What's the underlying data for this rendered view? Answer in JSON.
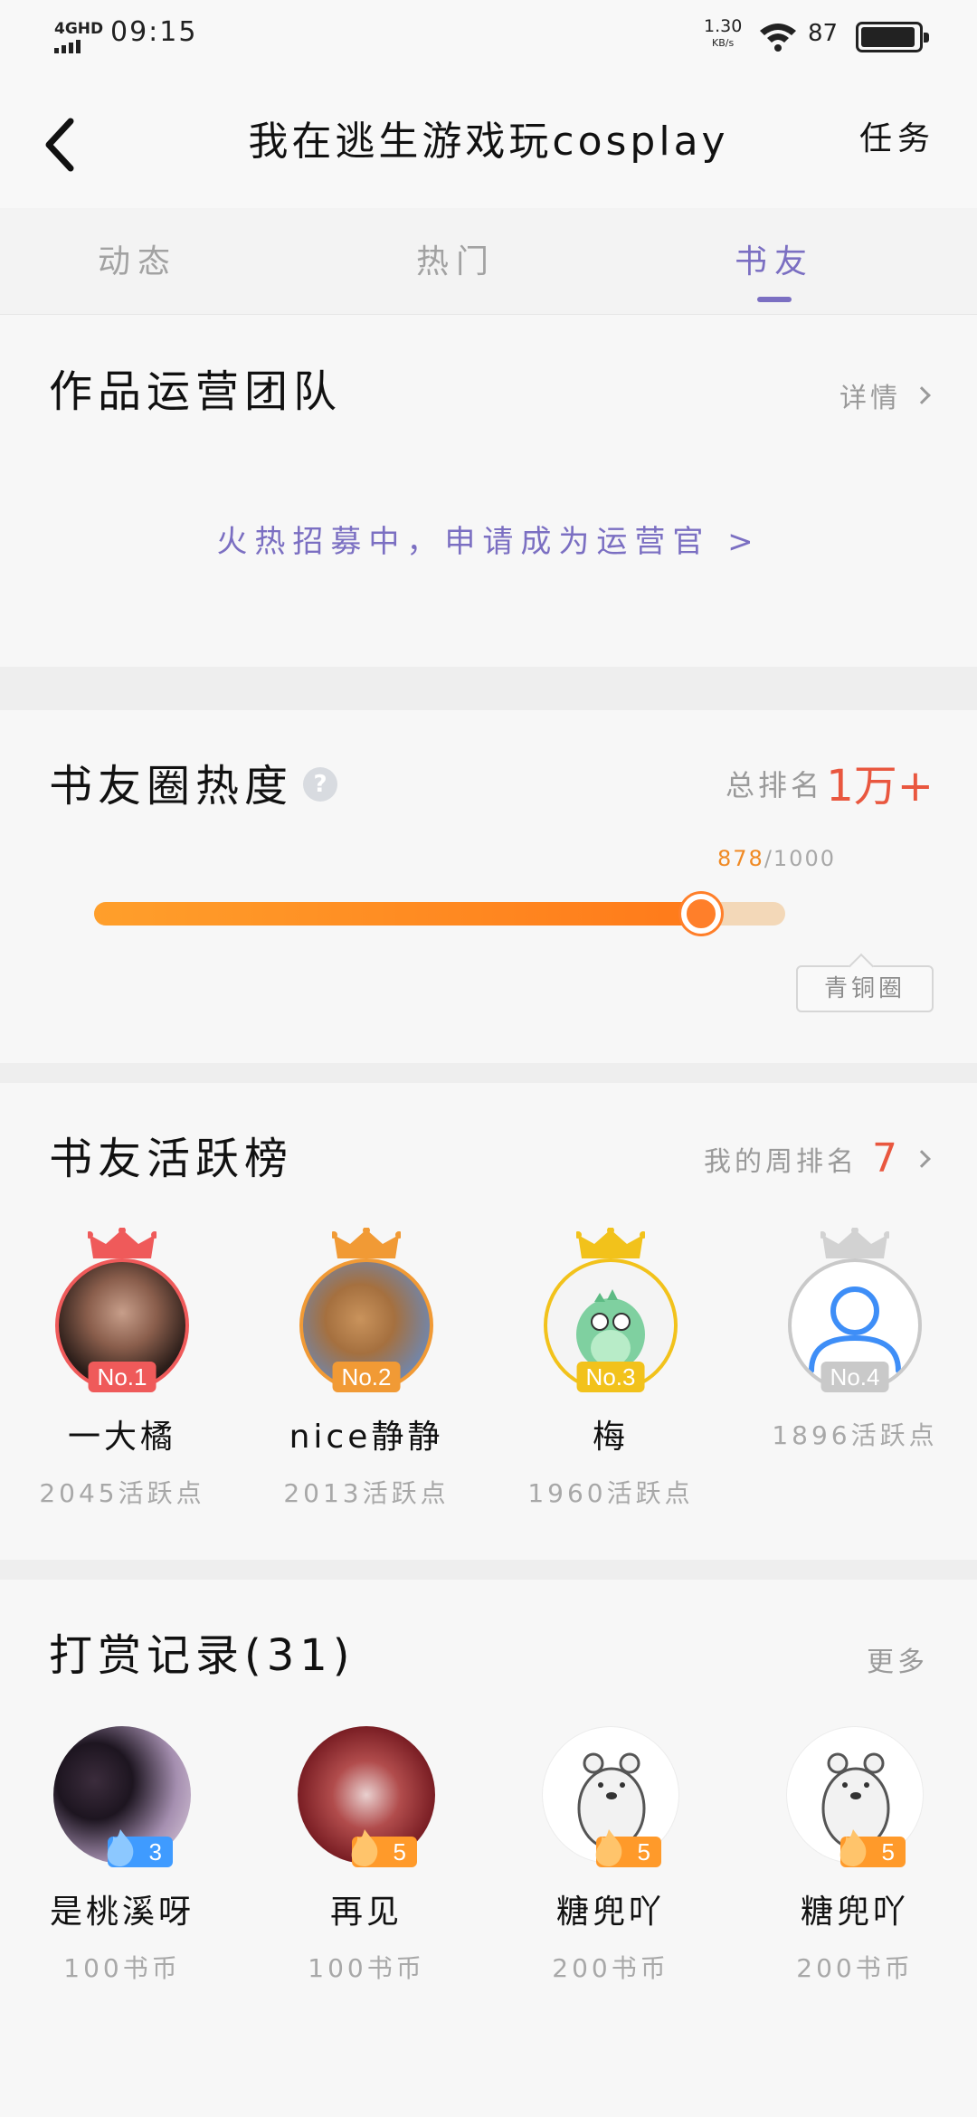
{
  "status_bar": {
    "network": "4GHD",
    "time": "09:15",
    "speed_value": "1.30",
    "speed_unit": "KB/s",
    "battery_percent": "87",
    "battery_level": 0.87
  },
  "nav": {
    "title": "我在逃生游戏玩cosplay",
    "task_label": "任务"
  },
  "tabs": [
    {
      "label": "动态",
      "active": false
    },
    {
      "label": "热门",
      "active": false
    },
    {
      "label": "书友",
      "active": true
    }
  ],
  "team": {
    "title": "作品运营团队",
    "details_label": "详情",
    "recruit_text": "火热招募中，申请成为运营官 >"
  },
  "heat": {
    "title": "书友圈热度",
    "help_icon": "?",
    "rank_label": "总排名",
    "rank_value": "1万+",
    "progress_current": "878",
    "progress_total": "/1000",
    "progress_fraction": 0.878,
    "tier": "青铜圈"
  },
  "active_board": {
    "title": "书友活跃榜",
    "my_rank_label": "我的周排名",
    "my_rank_value": "7",
    "entries": [
      {
        "badge": "No.1",
        "name": "一大橘",
        "points": "2045活跃点",
        "color": "#ef5a5a"
      },
      {
        "badge": "No.2",
        "name": "nice静静",
        "points": "2013活跃点",
        "color": "#f19a35"
      },
      {
        "badge": "No.3",
        "name": "梅",
        "points": "1960活跃点",
        "color": "#f2c21b"
      },
      {
        "badge": "No.4",
        "name": "",
        "points": "1896活跃点",
        "color": "#c9c9c9"
      }
    ]
  },
  "rewards": {
    "title": "打赏记录(31)",
    "more_label": "更多",
    "entries": [
      {
        "level": "3",
        "name": "是桃溪呀",
        "amount": "100书币",
        "level_color": "#3f9bff"
      },
      {
        "level": "5",
        "name": "再见",
        "amount": "100书币",
        "level_color": "#ff9a2a"
      },
      {
        "level": "5",
        "name": "糖兜吖",
        "amount": "200书币",
        "level_color": "#ff9a2a"
      },
      {
        "level": "5",
        "name": "糖兜吖",
        "amount": "200书币",
        "level_color": "#ff9a2a"
      }
    ]
  },
  "colors": {
    "accent": "#7b6fc2",
    "rank_red": "#e9573f",
    "progress_orange": "#ff8a24"
  }
}
